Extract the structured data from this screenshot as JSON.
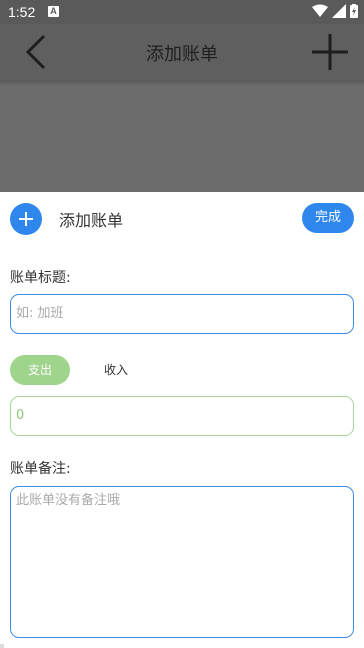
{
  "status_bar": {
    "time": "1:52",
    "notification_icon": "A"
  },
  "app_bar": {
    "title": "添加账单",
    "back_icon": "chevron-left-icon",
    "add_icon": "plus-icon"
  },
  "sheet": {
    "title": "添加账单",
    "done_label": "完成",
    "title_label": "账单标题:",
    "title_placeholder": "如: 加班",
    "type_buttons": {
      "expense": "支出",
      "income": "收入"
    },
    "amount_value": "0",
    "note_label": "账单备注:",
    "note_placeholder": "此账单没有备注哦"
  },
  "colors": {
    "accent": "#2f87ee",
    "green": "#9fd48c",
    "overlay": "#6c6c6c"
  }
}
